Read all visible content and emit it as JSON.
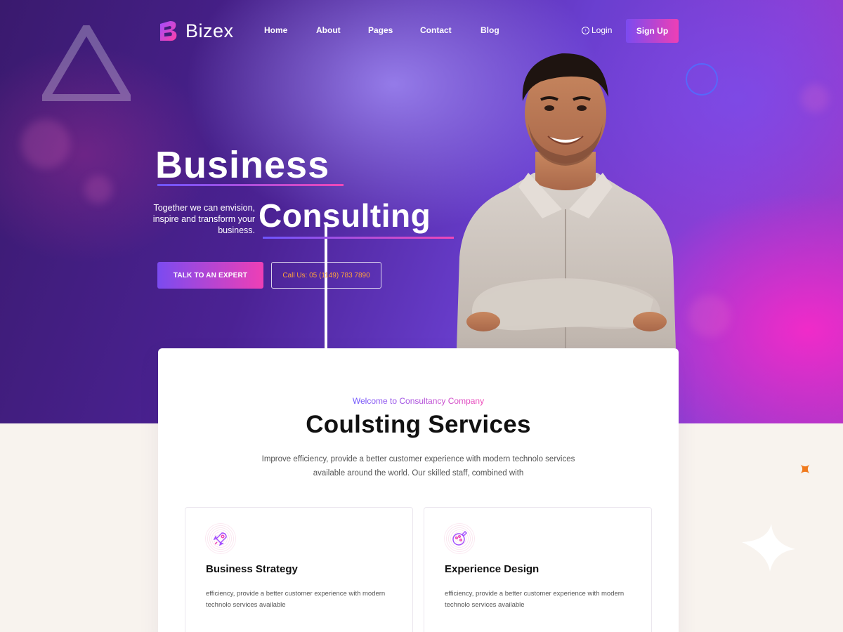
{
  "brand": {
    "name": "Bizex"
  },
  "nav": {
    "items": [
      "Home",
      "About",
      "Pages",
      "Contact",
      "Blog"
    ],
    "login": "Login",
    "signup": "Sign Up"
  },
  "hero": {
    "title_line1": "Business",
    "title_line2": "Consulting",
    "subtitle": "Together we can envision, inspire and transform your business.",
    "cta_primary": "TALK TO AN EXPERT",
    "cta_secondary": "Call Us: 05 (1149) 783 7890"
  },
  "services": {
    "eyebrow": "Welcome to Consultancy Company",
    "title": "Coulsting Services",
    "description": "Improve efficiency, provide a better customer experience with modern technolo services available around the world. Our skilled staff, combined with",
    "items": [
      {
        "title": "Business Strategy",
        "text": "efficiency, provide a better customer experience with modern technolo services available",
        "icon": "rocket-icon"
      },
      {
        "title": "Experience Design",
        "text": "efficiency, provide a better customer experience with modern technolo services available",
        "icon": "palette-icon"
      }
    ]
  },
  "colors": {
    "accent_start": "#7b4bf0",
    "accent_end": "#ee3fb5",
    "call_text": "#ffa13d",
    "section_bg": "#f8f3ee"
  }
}
